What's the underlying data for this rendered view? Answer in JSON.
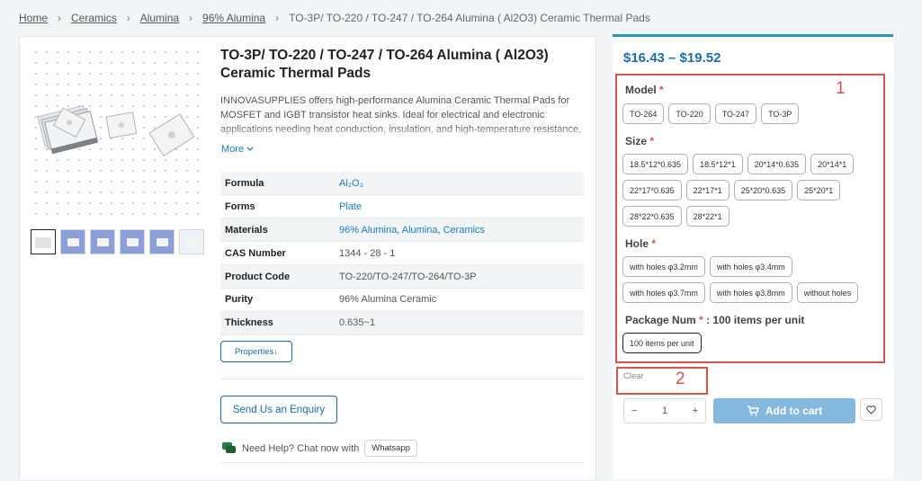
{
  "breadcrumb": {
    "items": [
      "Home",
      "Ceramics",
      "Alumina",
      "96% Alumina"
    ],
    "current": "TO-3P/ TO-220 / TO-247 / TO-264 Alumina ( Al2O3)  Ceramic Thermal Pads"
  },
  "product": {
    "title": "TO-3P/ TO-220 / TO-247 / TO-264 Alumina ( Al2O3) Ceramic Thermal Pads",
    "description": "INNOVASUPPLIES offers high-performance Alumina Ceramic Thermal Pads for MOSFET and IGBT transistor heat sinks. Ideal for electrical and electronic applications needing heat conduction, insulation, and high-temperature resistance, they are designed for efficient thermal management. Select from",
    "more_label": "More",
    "specs": [
      {
        "key": "Formula",
        "value": "Al₂O₃"
      },
      {
        "key": "Forms",
        "value": "Plate"
      },
      {
        "key": "Materials",
        "links": [
          "96% Alumina",
          "Alumina",
          "Ceramics"
        ]
      },
      {
        "key": "CAS Number",
        "value": "1344 - 28 - 1"
      },
      {
        "key": "Product Code",
        "value": "TO-220/TO-247/TO-264/TO-3P"
      },
      {
        "key": "Purity",
        "value": "96% Alumina Ceramic"
      },
      {
        "key": "Thickness",
        "value": "0.635~1"
      }
    ],
    "properties_btn": "Properties↓",
    "enquiry_btn": "Send Us an Enquiry",
    "help_text": "Need Help? Chat now with",
    "whatsapp_btn": "Whatsapp"
  },
  "purchase": {
    "price": "$16.43 – $19.52",
    "annotation_1": "1",
    "annotation_2": "2",
    "model_label": "Model",
    "models": [
      "TO-264",
      "TO-220",
      "TO-247",
      "TO-3P"
    ],
    "size_label": "Size",
    "sizes_row1": [
      "18.5*12*0.635",
      "18.5*12*1",
      "20*14*0.635",
      "20*14*1"
    ],
    "sizes_row2": [
      "22*17*0.635",
      "22*17*1",
      "25*20*0.635",
      "25*20*1"
    ],
    "sizes_row3": [
      "28*22*0.635",
      "28*22*1"
    ],
    "hole_label": "Hole",
    "holes_row1": [
      "with holes φ3.2mm",
      "with holes φ3.4mm"
    ],
    "holes_row2": [
      "with holes φ3.7mm",
      "with holes φ3.8mm",
      "without holes"
    ],
    "package_label": "Package Num",
    "package_value": ": 100 items per unit",
    "packages": [
      "100 items per unit"
    ],
    "selected_package": "100 items per unit",
    "clear_label": "Clear",
    "quantity": "1",
    "minus": "−",
    "plus": "+",
    "add_to_cart": "Add to cart",
    "required_mark": "*"
  },
  "colors": {
    "accent": "#1f6ca8",
    "link": "#1a7bc1",
    "annotation": "#d9534f",
    "cart_button": "#85b8de",
    "top_bar": "#1f9ab7"
  },
  "icons": [
    "chevron-down-icon",
    "chat-icon",
    "cart-icon",
    "heart-icon"
  ]
}
